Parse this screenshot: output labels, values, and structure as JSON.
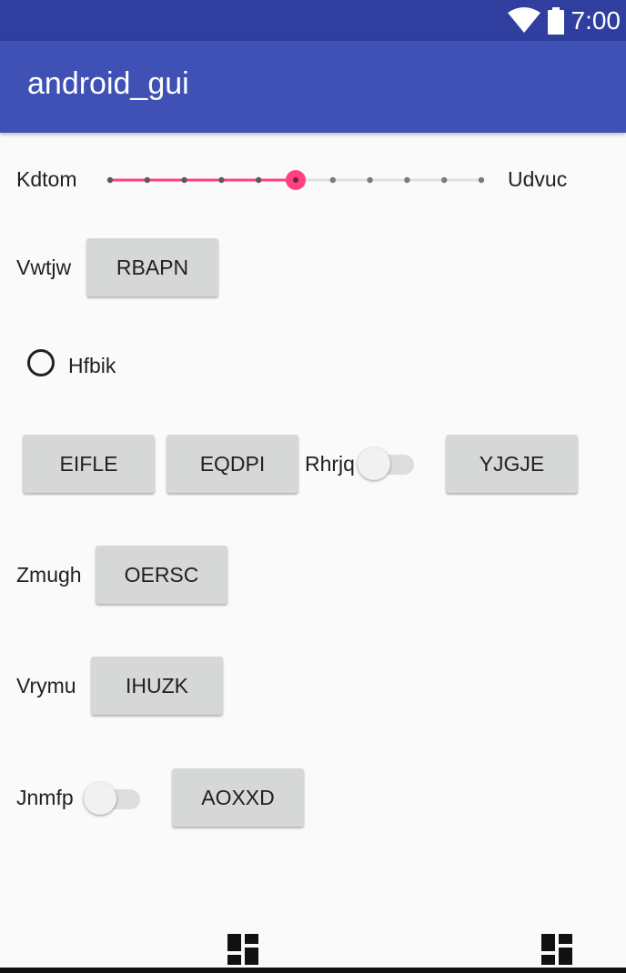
{
  "status_bar": {
    "time": "7:00",
    "icons": [
      "wifi-icon",
      "battery-icon"
    ]
  },
  "app_bar": {
    "title": "android_gui"
  },
  "slider_row": {
    "label_left": "Kdtom",
    "label_right": "Udvuc",
    "steps": 10,
    "value": 5
  },
  "row_vwtjw": {
    "label": "Vwtjw",
    "button": "RBAPN"
  },
  "radio": {
    "label": "Hfbik",
    "checked": false
  },
  "button_row": {
    "button1": "EIFLE",
    "button2": "EQDPI",
    "switch_label": "Rhrjq",
    "switch_on": false,
    "button3": "YJGJE"
  },
  "row_zmugh": {
    "label": "Zmugh",
    "button": "OERSC"
  },
  "row_vrymu": {
    "label": "Vrymu",
    "button": "IHUZK"
  },
  "row_jnmfp": {
    "switch_label": "Jnmfp",
    "switch_on": false,
    "button": "AOXXD"
  },
  "bottom_icons": [
    "dashboard-icon",
    "dashboard-icon"
  ],
  "colors": {
    "status_bar": "#303f9f",
    "app_bar": "#3f51b5",
    "accent": "#ff4081",
    "button": "#d6d7d7",
    "background": "#fafafa"
  }
}
